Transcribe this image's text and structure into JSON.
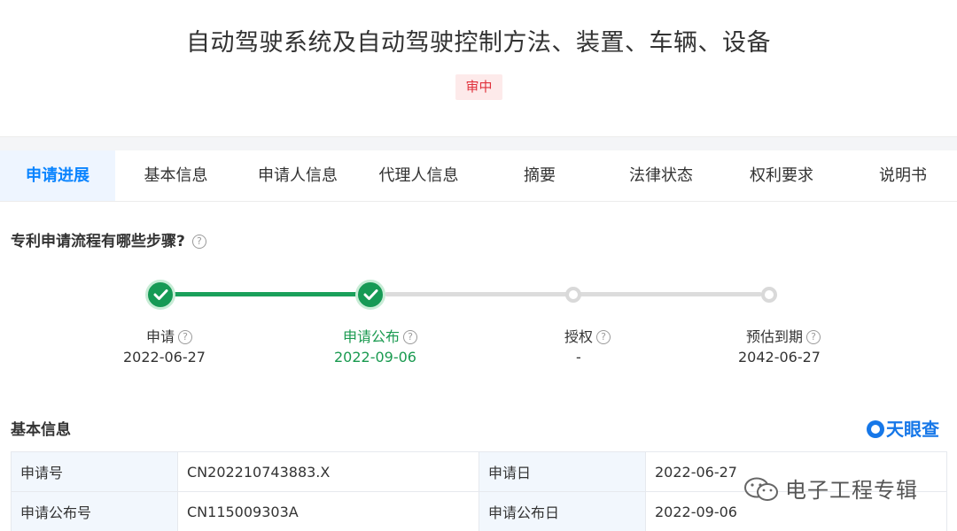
{
  "header": {
    "title": "自动驾驶系统及自动驾驶控制方法、装置、车辆、设备",
    "status_badge": "审中"
  },
  "tabs": [
    {
      "label": "申请进展",
      "active": true
    },
    {
      "label": "基本信息",
      "active": false
    },
    {
      "label": "申请人信息",
      "active": false
    },
    {
      "label": "代理人信息",
      "active": false
    },
    {
      "label": "摘要",
      "active": false
    },
    {
      "label": "法律状态",
      "active": false
    },
    {
      "label": "权利要求",
      "active": false
    },
    {
      "label": "说明书",
      "active": false
    }
  ],
  "process": {
    "question": "专利申请流程有哪些步骤?",
    "help_icon": "question-circle-icon",
    "steps": [
      {
        "label": "申请",
        "date": "2022-06-27",
        "status": "done"
      },
      {
        "label": "申请公布",
        "date": "2022-09-06",
        "status": "done"
      },
      {
        "label": "授权",
        "date": "-",
        "status": "pending"
      },
      {
        "label": "预估到期",
        "date": "2042-06-27",
        "status": "pending"
      }
    ],
    "colors": {
      "done": "#169a55",
      "pending": "#d9d9d9"
    }
  },
  "basic_info": {
    "heading": "基本信息",
    "brand": "天眼查",
    "rows": [
      {
        "k1": "申请号",
        "v1": "CN202210743883.X",
        "k2": "申请日",
        "v2": "2022-06-27"
      },
      {
        "k1": "申请公布号",
        "v1": "CN115009303A",
        "k2": "申请公布日",
        "v2": "2022-09-06"
      }
    ]
  },
  "watermark": {
    "text": "电子工程专辑",
    "icon": "wechat-icon"
  },
  "colors": {
    "accent": "#0a84ff",
    "success": "#169a55",
    "badge_text": "#e0323c",
    "badge_bg": "#fdeaea",
    "brand": "#1677e8"
  }
}
